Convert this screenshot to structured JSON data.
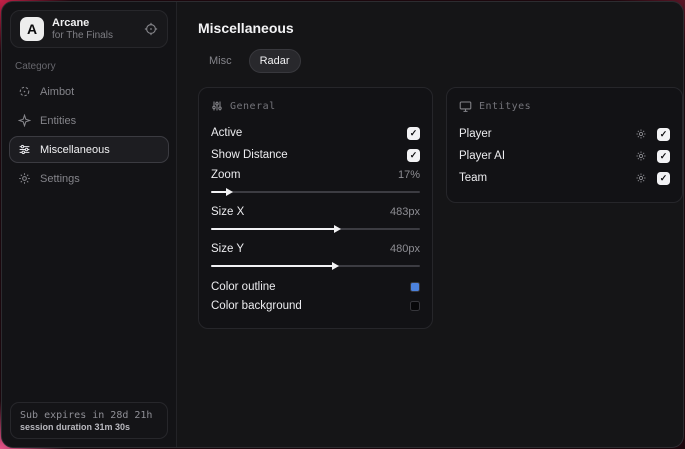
{
  "app": {
    "logo_letter": "A",
    "name": "Arcane",
    "subtitle": "for The Finals"
  },
  "sidebar": {
    "category_label": "Category",
    "items": [
      {
        "label": "Aimbot"
      },
      {
        "label": "Entities"
      },
      {
        "label": "Miscellaneous"
      },
      {
        "label": "Settings"
      }
    ],
    "footer": {
      "sub_expiry": "Sub expires in 28d 21h",
      "session_duration": "session duration 31m 30s"
    }
  },
  "main": {
    "title": "Miscellaneous",
    "tabs": [
      {
        "label": "Misc",
        "active": false
      },
      {
        "label": "Radar",
        "active": true
      }
    ],
    "general": {
      "title": "General",
      "toggles": [
        {
          "label": "Active",
          "checked": true,
          "check_glyph": "✓"
        },
        {
          "label": "Show Distance",
          "checked": true,
          "check_glyph": "✓"
        }
      ],
      "sliders": [
        {
          "label": "Zoom",
          "value": "17%",
          "fill_pct": 8
        },
        {
          "label": "Size X",
          "value": "483px",
          "fill_pct": 60
        },
        {
          "label": "Size Y",
          "value": "480px",
          "fill_pct": 59
        }
      ],
      "colors": [
        {
          "label": "Color outline",
          "swatch": "#4c82dd"
        },
        {
          "label": "Color background",
          "swatch": "#070709"
        }
      ]
    },
    "entities": {
      "title": "Entityes",
      "rows": [
        {
          "label": "Player",
          "checked": true,
          "check_glyph": "✓"
        },
        {
          "label": "Player AI",
          "checked": true,
          "check_glyph": "✓"
        },
        {
          "label": "Team",
          "checked": true,
          "check_glyph": "✓"
        }
      ]
    }
  },
  "colors": {
    "accent_blue": "#4c82dd",
    "backdrop_red": "#c22047"
  }
}
